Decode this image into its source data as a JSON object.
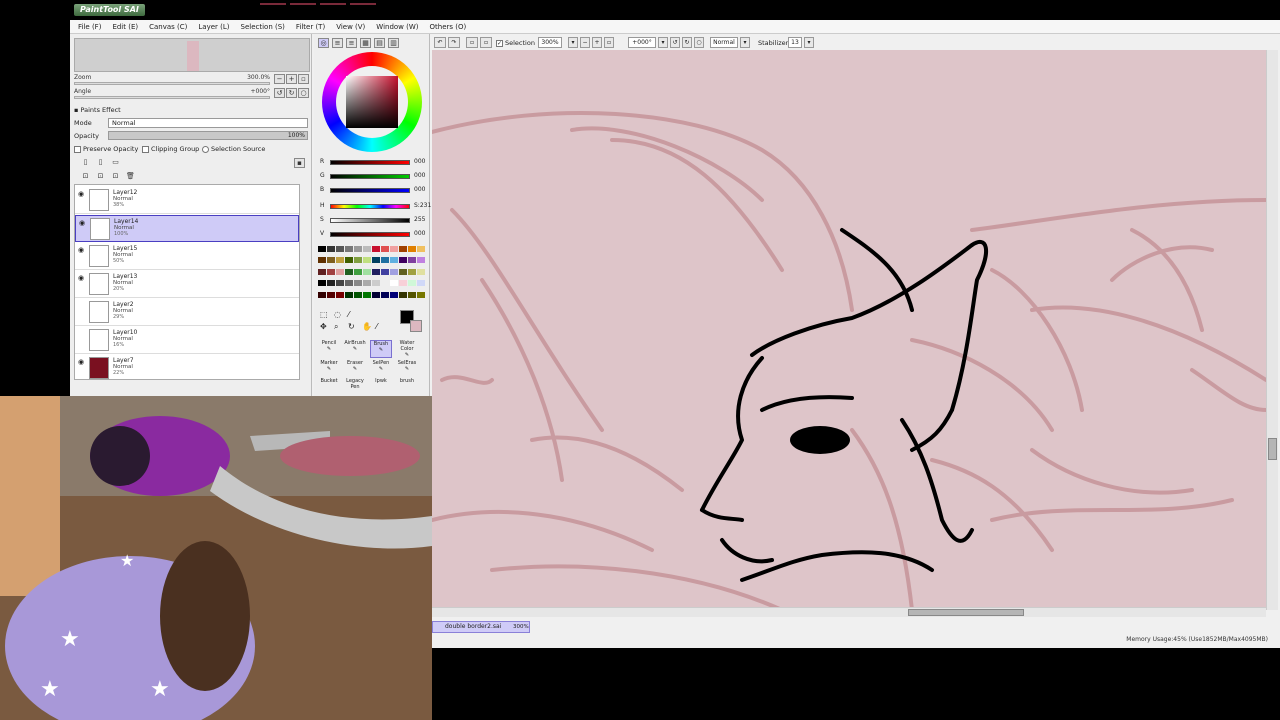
{
  "app": {
    "logo_text": "PaintTool SAI"
  },
  "menu": [
    "File (F)",
    "Edit (E)",
    "Canvas (C)",
    "Layer (L)",
    "Selection (S)",
    "Filter (T)",
    "View (V)",
    "Window (W)",
    "Others (O)"
  ],
  "navigator": {
    "zoom_label": "Zoom",
    "zoom_value": "300.0%",
    "angle_label": "Angle",
    "angle_value": "+000°"
  },
  "paint_effect": {
    "title": "Paints Effect",
    "mode_label": "Mode",
    "mode_value": "Normal",
    "opacity_label": "Opacity",
    "opacity_value": "100%",
    "preserve_opacity": "Preserve Opacity",
    "clipping_group": "Clipping Group",
    "selection_source": "Selection Source"
  },
  "layers": [
    {
      "name": "Layer12",
      "mode": "Normal",
      "opacity": "38%",
      "selected": false,
      "visible": true,
      "thumb": "#ffffff"
    },
    {
      "name": "Layer14",
      "mode": "Normal",
      "opacity": "100%",
      "selected": true,
      "visible": true,
      "thumb": "#ffffff"
    },
    {
      "name": "Layer15",
      "mode": "Normal",
      "opacity": "50%",
      "selected": false,
      "visible": true,
      "thumb": "#ffffff"
    },
    {
      "name": "Layer13",
      "mode": "Normal",
      "opacity": "20%",
      "selected": false,
      "visible": true,
      "thumb": "#ffffff"
    },
    {
      "name": "Layer2",
      "mode": "Normal",
      "opacity": "29%",
      "selected": false,
      "visible": false,
      "thumb": "#ffffff"
    },
    {
      "name": "Layer10",
      "mode": "Normal",
      "opacity": "16%",
      "selected": false,
      "visible": false,
      "thumb": "#ffffff"
    },
    {
      "name": "Layer7",
      "mode": "Normal",
      "opacity": "22%",
      "selected": false,
      "visible": true,
      "thumb": "#7a1020"
    }
  ],
  "color": {
    "r_label": "R",
    "r_value": "000",
    "g_label": "G",
    "g_value": "000",
    "b_label": "B",
    "b_value": "000",
    "h_label": "H",
    "h_value": "S:231",
    "s_label": "S",
    "s_value": "255",
    "v_label": "V",
    "v_value": "000"
  },
  "tools": [
    "Pencil",
    "AirBrush",
    "Brush",
    "Water Color",
    "Marker",
    "Eraser",
    "SelPen",
    "SelEras",
    "Bucket",
    "Legacy Pen",
    "Ipwk",
    "brush"
  ],
  "active_tool": "Brush",
  "toolbar": {
    "selection": "Selection",
    "zoom": "300%",
    "angle": "+000°",
    "mode": "Normal",
    "stabilizer_label": "Stabilizer",
    "stabilizer_value": "13"
  },
  "document": {
    "tab_name": "double border2.sai",
    "tab_zoom": "300%"
  },
  "status": {
    "memory": "Memory Usage:45% (Use1852MB/Max4095MB)"
  },
  "colors": {
    "canvas_bg": "#dec5c9",
    "sketch": "#c99ba0",
    "selected_layer": "#cfcbf7"
  }
}
